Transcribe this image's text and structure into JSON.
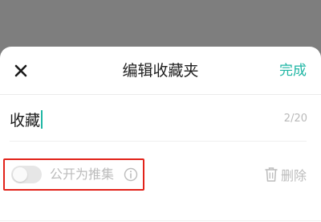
{
  "dialog": {
    "title": "编辑收藏夹",
    "close_icon": "close-icon",
    "done_label": "完成"
  },
  "name_field": {
    "value": "收藏",
    "counter": "2/20"
  },
  "public_toggle": {
    "label": "公开为推集",
    "on": false,
    "info_icon": "info-icon"
  },
  "delete": {
    "label": "删除",
    "icon": "trash-icon"
  },
  "colors": {
    "accent": "#1fb6a4",
    "highlight_border": "#e2231a",
    "overlay": "#7e7e7e"
  }
}
